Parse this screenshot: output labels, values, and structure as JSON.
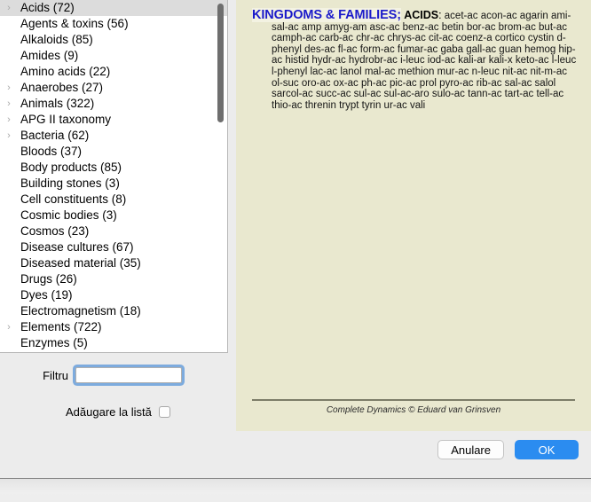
{
  "list": {
    "selected_index": 0,
    "items": [
      {
        "label": "Acids (72)",
        "expandable": true
      },
      {
        "label": "Agents & toxins (56)",
        "expandable": false
      },
      {
        "label": "Alkaloids (85)",
        "expandable": false
      },
      {
        "label": "Amides (9)",
        "expandable": false
      },
      {
        "label": "Amino acids (22)",
        "expandable": false
      },
      {
        "label": "Anaerobes (27)",
        "expandable": true
      },
      {
        "label": "Animals (322)",
        "expandable": true
      },
      {
        "label": "APG II taxonomy",
        "expandable": true
      },
      {
        "label": "Bacteria (62)",
        "expandable": true
      },
      {
        "label": "Bloods (37)",
        "expandable": false
      },
      {
        "label": "Body products (85)",
        "expandable": false
      },
      {
        "label": "Building stones (3)",
        "expandable": false
      },
      {
        "label": "Cell constituents (8)",
        "expandable": false
      },
      {
        "label": "Cosmic bodies (3)",
        "expandable": false
      },
      {
        "label": "Cosmos (23)",
        "expandable": false
      },
      {
        "label": "Disease cultures (67)",
        "expandable": false
      },
      {
        "label": "Diseased material (35)",
        "expandable": false
      },
      {
        "label": "Drugs (26)",
        "expandable": false
      },
      {
        "label": "Dyes (19)",
        "expandable": false
      },
      {
        "label": "Electromagnetism (18)",
        "expandable": false
      },
      {
        "label": "Elements (722)",
        "expandable": true
      },
      {
        "label": "Enzymes (5)",
        "expandable": false
      }
    ],
    "twisty_glyph": "›"
  },
  "controls": {
    "filter_label": "Filtru",
    "filter_value": "",
    "filter_placeholder": "",
    "add_to_list_label": "Adăugare la listă",
    "add_to_list_checked": false
  },
  "info": {
    "title": "KINGDOMS & FAMILIES;",
    "subtitle": "ACIDS",
    "colon": ":",
    "remedies": "acet-ac acon-ac agarin ami-sal-ac amp amyg-am asc-ac benz-ac betin bor-ac brom-ac but-ac camph-ac carb-ac chr-ac chrys-ac cit-ac coenz-a cortico cystin d-phenyl des-ac fl-ac form-ac fumar-ac gaba gall-ac guan hemog hip-ac histid hydr-ac hydrobr-ac i-leuc iod-ac kali-ar kali-x keto-ac l-leuc l-phenyl lac-ac lanol mal-ac methion mur-ac n-leuc nit-ac nit-m-ac ol-suc oro-ac ox-ac ph-ac pic-ac prol pyro-ac rib-ac sal-ac salol sarcol-ac succ-ac sul-ac sul-ac-aro sulo-ac tann-ac tart-ac tell-ac thio-ac threnin trypt tyrin ur-ac vali",
    "credit": "Complete Dynamics © Eduard van Grinsven"
  },
  "buttons": {
    "cancel_label": "Anulare",
    "ok_label": "OK"
  },
  "colors": {
    "panel_background": "#e9e8cf",
    "title_blue": "#1a1aca",
    "ok_blue": "#2b8cf0",
    "selection_gray": "#dcdcdc"
  }
}
